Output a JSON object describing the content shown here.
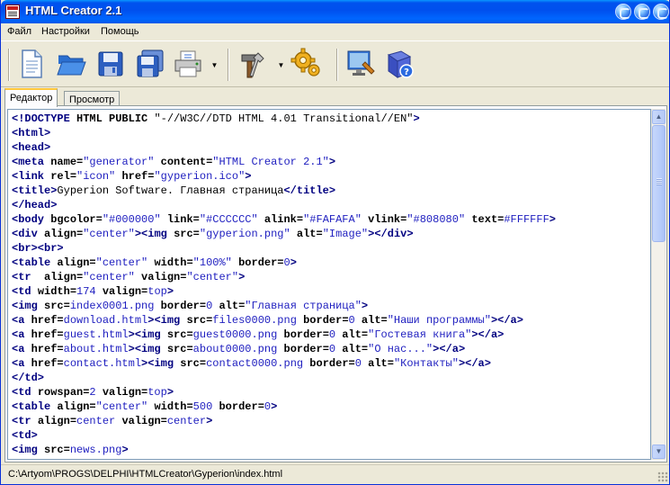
{
  "window": {
    "title": "HTML Creator 2.1"
  },
  "menu": {
    "items": [
      "Файл",
      "Настройки",
      "Помощь"
    ]
  },
  "toolbar": {
    "buttons": [
      {
        "icon": "new-document-icon"
      },
      {
        "icon": "open-folder-icon"
      },
      {
        "icon": "save-icon"
      },
      {
        "icon": "save-all-icon"
      },
      {
        "icon": "print-icon"
      },
      {
        "icon": "tools-icon"
      },
      {
        "icon": "settings-gear-icon"
      },
      {
        "icon": "preview-browser-icon"
      },
      {
        "icon": "help-book-icon"
      }
    ]
  },
  "tabs": [
    {
      "label": "Редактор",
      "active": true
    },
    {
      "label": "Просмотр",
      "active": false
    }
  ],
  "editor": {
    "lines": [
      [
        [
          "tag",
          "<!DOCTYPE "
        ],
        [
          "attr",
          "HTML PUBLIC "
        ],
        [
          "sym",
          "\"-//W3C//DTD HTML 4.01 Transitional//EN\""
        ],
        [
          "tag",
          ">"
        ]
      ],
      [
        [
          "tag",
          "<html>"
        ]
      ],
      [
        [
          "tag",
          "<head>"
        ]
      ],
      [
        [
          "tag",
          "<meta "
        ],
        [
          "attr",
          "name="
        ],
        [
          "val",
          "\"generator\""
        ],
        [
          "attr",
          " content="
        ],
        [
          "val",
          "\"HTML Creator 2.1\""
        ],
        [
          "tag",
          ">"
        ]
      ],
      [
        [
          "tag",
          "<link "
        ],
        [
          "attr",
          "rel="
        ],
        [
          "val",
          "\"icon\""
        ],
        [
          "attr",
          " href="
        ],
        [
          "val",
          "\"gyperion.ico\""
        ],
        [
          "tag",
          ">"
        ]
      ],
      [
        [
          "tag",
          "<title>"
        ],
        [
          "text",
          "Gyperion Software. Главная страница"
        ],
        [
          "tag",
          "</title>"
        ]
      ],
      [
        [
          "tag",
          "</head>"
        ]
      ],
      [
        [
          "tag",
          "<body "
        ],
        [
          "attr",
          "bgcolor="
        ],
        [
          "val",
          "\"#000000\""
        ],
        [
          "attr",
          " link="
        ],
        [
          "val",
          "\"#CCCCCC\""
        ],
        [
          "attr",
          " alink="
        ],
        [
          "val",
          "\"#FAFAFA\""
        ],
        [
          "attr",
          " vlink="
        ],
        [
          "val",
          "\"#808080\""
        ],
        [
          "attr",
          " text="
        ],
        [
          "val",
          "#FFFFFF"
        ],
        [
          "tag",
          ">"
        ]
      ],
      [
        [
          "tag",
          "<div "
        ],
        [
          "attr",
          "align="
        ],
        [
          "val",
          "\"center\""
        ],
        [
          "tag",
          "><img "
        ],
        [
          "attr",
          "src="
        ],
        [
          "val",
          "\"gyperion.png\""
        ],
        [
          "attr",
          " alt="
        ],
        [
          "val",
          "\"Image\""
        ],
        [
          "tag",
          "></div>"
        ]
      ],
      [
        [
          "tag",
          "<br><br>"
        ]
      ],
      [
        [
          "tag",
          "<table "
        ],
        [
          "attr",
          "align="
        ],
        [
          "val",
          "\"center\""
        ],
        [
          "attr",
          " width="
        ],
        [
          "val",
          "\"100%\""
        ],
        [
          "attr",
          " border="
        ],
        [
          "val",
          "0"
        ],
        [
          "tag",
          ">"
        ]
      ],
      [
        [
          "tag",
          "<tr  "
        ],
        [
          "attr",
          "align="
        ],
        [
          "val",
          "\"center\""
        ],
        [
          "attr",
          " valign="
        ],
        [
          "val",
          "\"center\""
        ],
        [
          "tag",
          ">"
        ]
      ],
      [
        [
          "tag",
          "<td "
        ],
        [
          "attr",
          "width="
        ],
        [
          "val",
          "174"
        ],
        [
          "attr",
          " valign="
        ],
        [
          "val",
          "top"
        ],
        [
          "tag",
          ">"
        ]
      ],
      [
        [
          "tag",
          "<img "
        ],
        [
          "attr",
          "src="
        ],
        [
          "val",
          "index0001.png"
        ],
        [
          "attr",
          " border="
        ],
        [
          "val",
          "0"
        ],
        [
          "attr",
          " alt="
        ],
        [
          "val",
          "\"Главная страница\""
        ],
        [
          "tag",
          ">"
        ]
      ],
      [
        [
          "tag",
          "<a "
        ],
        [
          "attr",
          "href="
        ],
        [
          "val",
          "download.html"
        ],
        [
          "tag",
          "><img "
        ],
        [
          "attr",
          "src="
        ],
        [
          "val",
          "files0000.png"
        ],
        [
          "attr",
          " border="
        ],
        [
          "val",
          "0"
        ],
        [
          "attr",
          " alt="
        ],
        [
          "val",
          "\"Наши программы\""
        ],
        [
          "tag",
          "></a>"
        ]
      ],
      [
        [
          "tag",
          "<a "
        ],
        [
          "attr",
          "href="
        ],
        [
          "val",
          "guest.html"
        ],
        [
          "tag",
          "><img "
        ],
        [
          "attr",
          "src="
        ],
        [
          "val",
          "guest0000.png"
        ],
        [
          "attr",
          " border="
        ],
        [
          "val",
          "0"
        ],
        [
          "attr",
          " alt="
        ],
        [
          "val",
          "\"Гостевая книга\""
        ],
        [
          "tag",
          "></a>"
        ]
      ],
      [
        [
          "tag",
          "<a "
        ],
        [
          "attr",
          "href="
        ],
        [
          "val",
          "about.html"
        ],
        [
          "tag",
          "><img "
        ],
        [
          "attr",
          "src="
        ],
        [
          "val",
          "about0000.png"
        ],
        [
          "attr",
          " border="
        ],
        [
          "val",
          "0"
        ],
        [
          "attr",
          " alt="
        ],
        [
          "val",
          "\"О нас...\""
        ],
        [
          "tag",
          "></a>"
        ]
      ],
      [
        [
          "tag",
          "<a "
        ],
        [
          "attr",
          "href="
        ],
        [
          "val",
          "contact.html"
        ],
        [
          "tag",
          "><img "
        ],
        [
          "attr",
          "src="
        ],
        [
          "val",
          "contact0000.png"
        ],
        [
          "attr",
          " border="
        ],
        [
          "val",
          "0"
        ],
        [
          "attr",
          " alt="
        ],
        [
          "val",
          "\"Контакты\""
        ],
        [
          "tag",
          "></a>"
        ]
      ],
      [
        [
          "tag",
          "</td>"
        ]
      ],
      [
        [
          "tag",
          "<td "
        ],
        [
          "attr",
          "rowspan="
        ],
        [
          "val",
          "2"
        ],
        [
          "attr",
          " valign="
        ],
        [
          "val",
          "top"
        ],
        [
          "tag",
          ">"
        ]
      ],
      [
        [
          "tag",
          "<table "
        ],
        [
          "attr",
          "align="
        ],
        [
          "val",
          "\"center\""
        ],
        [
          "attr",
          " width="
        ],
        [
          "val",
          "500"
        ],
        [
          "attr",
          " border="
        ],
        [
          "val",
          "0"
        ],
        [
          "tag",
          ">"
        ]
      ],
      [
        [
          "tag",
          "<tr "
        ],
        [
          "attr",
          "align="
        ],
        [
          "val",
          "center"
        ],
        [
          "attr",
          " valign="
        ],
        [
          "val",
          "center"
        ],
        [
          "tag",
          ">"
        ]
      ],
      [
        [
          "tag",
          "<td>"
        ]
      ],
      [
        [
          "tag",
          "<img "
        ],
        [
          "attr",
          "src="
        ],
        [
          "val",
          "news.png"
        ],
        [
          "tag",
          ">"
        ]
      ],
      [
        [
          "tag",
          "<"
        ]
      ]
    ]
  },
  "status": {
    "path": "C:\\Artyom\\PROGS\\DELPHI\\HTMLCreator\\Gyperion\\index.html"
  }
}
